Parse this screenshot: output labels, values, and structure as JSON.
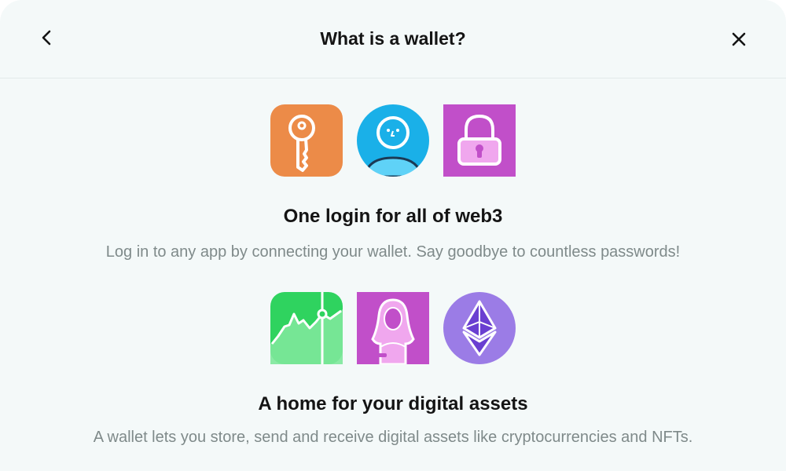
{
  "header": {
    "title": "What is a wallet?",
    "back_icon": "chevron-left-icon",
    "close_icon": "close-icon"
  },
  "sections": [
    {
      "title": "One login for all of web3",
      "description": "Log in to any app by connecting your wallet. Say goodbye to countless passwords!",
      "icons": [
        "key-icon",
        "user-face-icon",
        "padlock-icon"
      ]
    },
    {
      "title": "A home for your digital assets",
      "description": "A wallet lets you store, send and receive digital assets like cryptocurrencies and NFTs.",
      "icons": [
        "chart-icon",
        "nft-portrait-icon",
        "ethereum-icon"
      ]
    }
  ],
  "colors": {
    "background": "#f4f9f9",
    "key_tile": "#ec8b48",
    "user_tile": "#1ab0e8",
    "padlock_tile": "#c14fc9",
    "chart_tile": "#2fd35f",
    "nft_tile": "#c14fc9",
    "eth_tile": "#9b7ce6"
  }
}
